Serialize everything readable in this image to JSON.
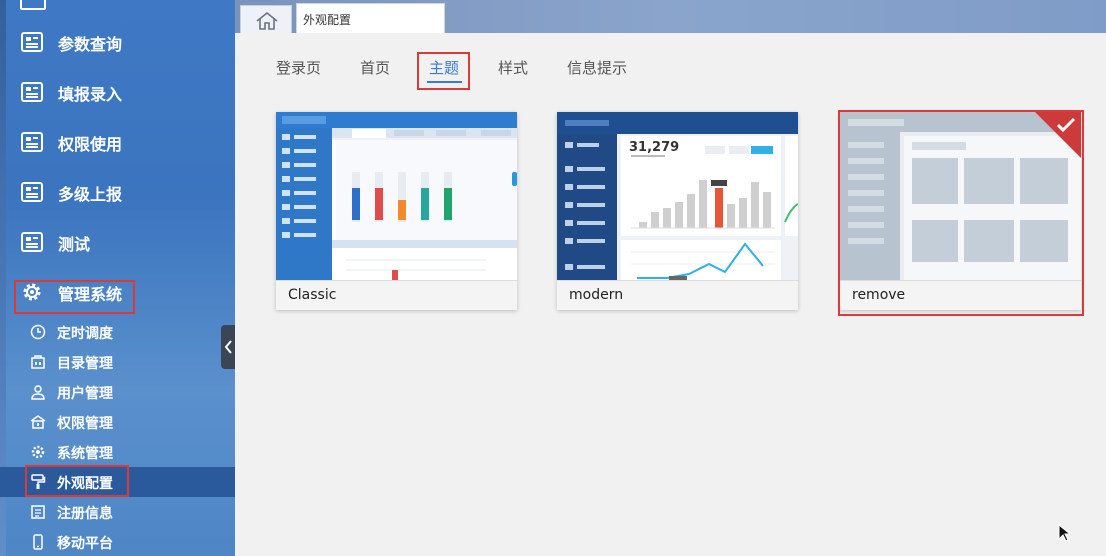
{
  "sidebar": {
    "top_items": [
      {
        "label": "参数查询",
        "icon": "newspaper-icon"
      },
      {
        "label": "填报录入",
        "icon": "newspaper-icon"
      },
      {
        "label": "权限使用",
        "icon": "newspaper-icon"
      },
      {
        "label": "多级上报",
        "icon": "newspaper-icon"
      },
      {
        "label": "测试",
        "icon": "newspaper-icon"
      }
    ],
    "management": {
      "label": "管理系统",
      "icon": "gear-icon"
    },
    "sub_items": [
      {
        "label": "定时调度",
        "icon": "clock-icon"
      },
      {
        "label": "目录管理",
        "icon": "building-icon"
      },
      {
        "label": "用户管理",
        "icon": "user-icon"
      },
      {
        "label": "权限管理",
        "icon": "lock-icon"
      },
      {
        "label": "系统管理",
        "icon": "gear-icon"
      },
      {
        "label": "外观配置",
        "icon": "paint-roller-icon",
        "active": true
      },
      {
        "label": "注册信息",
        "icon": "document-icon"
      },
      {
        "label": "移动平台",
        "icon": "mobile-icon"
      }
    ]
  },
  "tabs": {
    "home": {
      "icon": "home-icon"
    },
    "current": {
      "label": "外观配置"
    }
  },
  "subtabs": [
    {
      "label": "登录页"
    },
    {
      "label": "首页"
    },
    {
      "label": "主题",
      "active": true
    },
    {
      "label": "样式"
    },
    {
      "label": "信息提示"
    }
  ],
  "themes": [
    {
      "name": "Classic"
    },
    {
      "name": "modern",
      "metric": "31,279"
    },
    {
      "name": "remove",
      "selected": true
    }
  ],
  "colors": {
    "accent": "#3a7bd5",
    "highlight": "#d93a3a",
    "sidebar_active": "#2a5a9c"
  }
}
